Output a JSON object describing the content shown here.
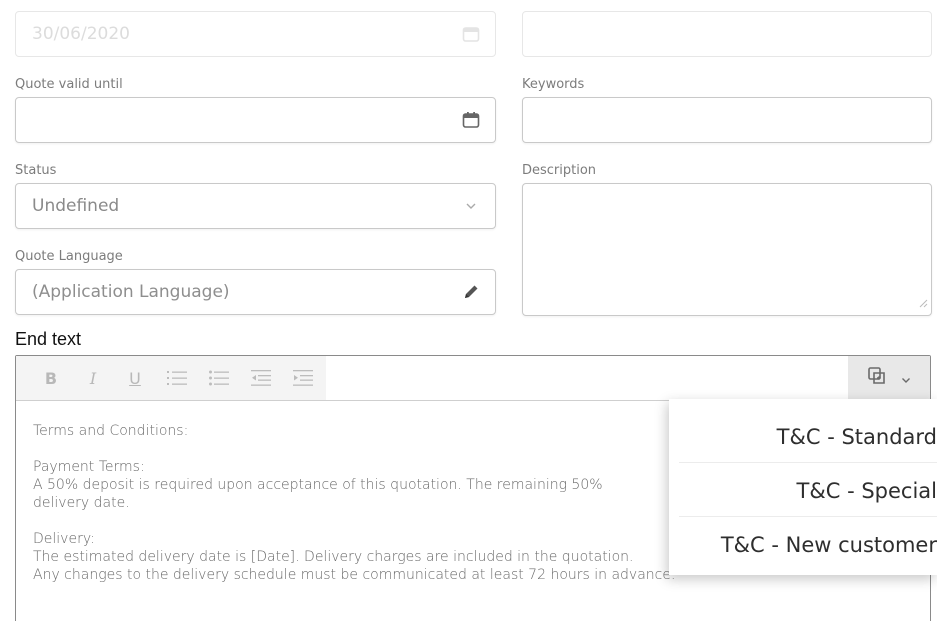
{
  "top_fields": {
    "date_value": "30/06/2020",
    "right_value": ""
  },
  "quote_valid": {
    "label": "Quote valid until",
    "value": ""
  },
  "keywords": {
    "label": "Keywords",
    "value": ""
  },
  "status": {
    "label": "Status",
    "value": "Undefined"
  },
  "description": {
    "label": "Description",
    "value": ""
  },
  "quote_language": {
    "label": "Quote Language",
    "value": "(Application Language)"
  },
  "end_text": {
    "label": "End text",
    "toolbar": {
      "bold": "B",
      "italic": "I",
      "underline": "U"
    },
    "body": {
      "p1": "Terms and Conditions:",
      "p2_title": "Payment Terms:",
      "p2_line1": "A 50% deposit is required upon acceptance of this quotation. The remaining 50%",
      "p2_line2": "delivery date.",
      "p3_title": "Delivery:",
      "p3_line1": "The estimated delivery date is [Date]. Delivery charges are included in the quotation.",
      "p3_line2": "Any changes to the delivery schedule must be communicated at least 72 hours in advance."
    }
  },
  "template_menu": {
    "items": [
      "T&C - Standard",
      "T&C - Special",
      "T&C - New customer"
    ]
  },
  "icons": {
    "calendar": "calendar-icon",
    "chevron": "chevron-down-icon",
    "pencil": "pencil-icon",
    "template": "insert-template-icon"
  }
}
